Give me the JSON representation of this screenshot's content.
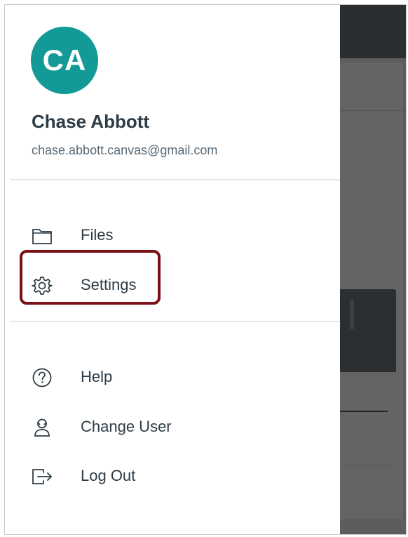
{
  "user": {
    "initials": "CA",
    "name": "Chase Abbott",
    "email": "chase.abbott.canvas@gmail.com",
    "avatar_color": "#139a96"
  },
  "menu": {
    "primary": [
      {
        "label": "Files",
        "icon": "folder-icon"
      },
      {
        "label": "Settings",
        "icon": "gear-icon",
        "highlighted": true
      }
    ],
    "secondary": [
      {
        "label": "Help",
        "icon": "help-circle-icon"
      },
      {
        "label": "Change User",
        "icon": "change-user-icon"
      },
      {
        "label": "Log Out",
        "icon": "log-out-icon"
      }
    ]
  },
  "colors": {
    "text_primary": "#2d3b45",
    "text_secondary": "#586874",
    "highlight_border": "#7a0f16",
    "overlay": "#5d5d5d"
  }
}
